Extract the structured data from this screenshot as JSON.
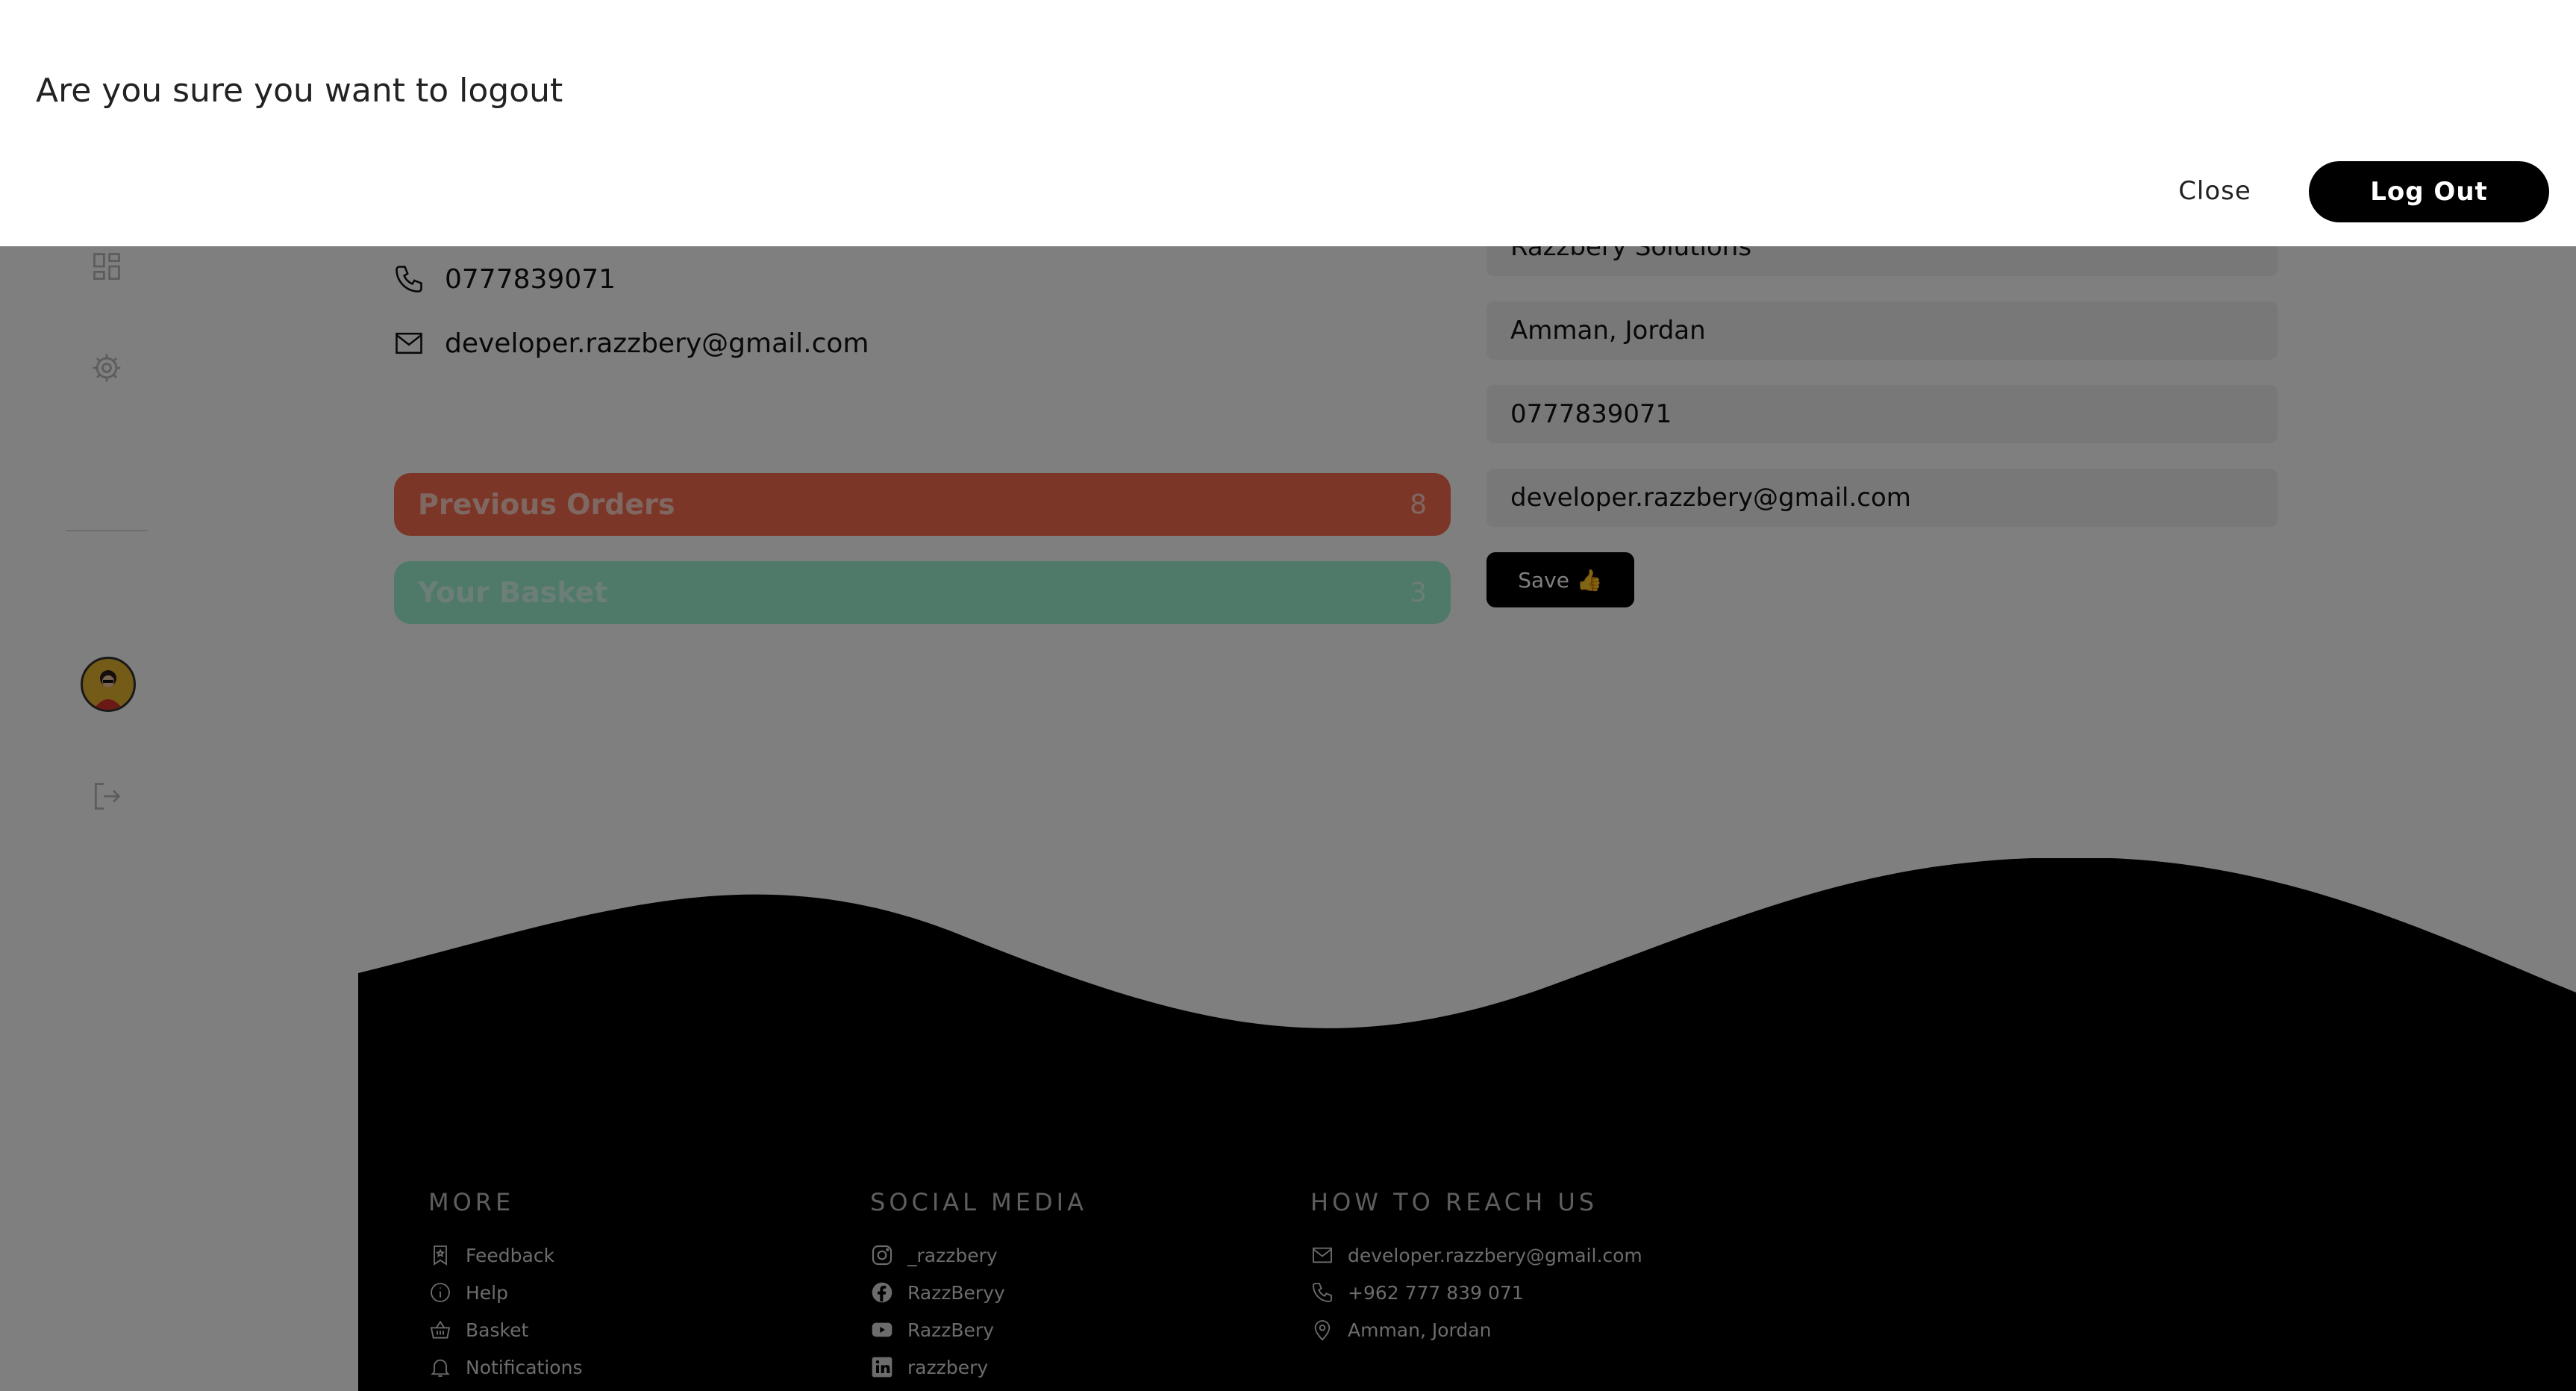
{
  "modal": {
    "title": "Are you sure you want to logout",
    "close_label": "Close",
    "logout_label": "Log Out"
  },
  "profile": {
    "phone": "0777839071",
    "email": "developer.razzbery@gmail.com",
    "previous_orders_label": "Previous Orders",
    "previous_orders_count": "8",
    "basket_label": "Your Basket",
    "basket_count": "3"
  },
  "form": {
    "company": "Razzbery Solutions",
    "location": "Amman, Jordan",
    "phone": "0777839071",
    "email": "developer.razzbery@gmail.com",
    "save_label": "Save",
    "save_emoji": "👍"
  },
  "footer": {
    "more": {
      "heading": "MORE",
      "items": [
        {
          "label": "Feedback",
          "icon": "bookmark-star-icon"
        },
        {
          "label": "Help",
          "icon": "info-icon"
        },
        {
          "label": "Basket",
          "icon": "basket-icon"
        },
        {
          "label": "Notifications",
          "icon": "bell-icon"
        }
      ]
    },
    "social": {
      "heading": "SOCIAL MEDIA",
      "items": [
        {
          "label": "_razzbery",
          "icon": "instagram-icon"
        },
        {
          "label": "RazzBeryy",
          "icon": "facebook-icon"
        },
        {
          "label": "RazzBery",
          "icon": "youtube-icon"
        },
        {
          "label": "razzbery",
          "icon": "linkedin-icon"
        }
      ]
    },
    "reach": {
      "heading": "HOW TO REACH US",
      "items": [
        {
          "label": "developer.razzbery@gmail.com",
          "icon": "mail-icon"
        },
        {
          "label": "+962 777 839 071",
          "icon": "phone-icon"
        },
        {
          "label": "Amman, Jordan",
          "icon": "location-pin-icon"
        }
      ]
    }
  },
  "colors": {
    "orders_pill": "#f96d4f",
    "basket_pill": "#9ff2d0",
    "overlay": "rgba(0,0,0,0.5)"
  }
}
